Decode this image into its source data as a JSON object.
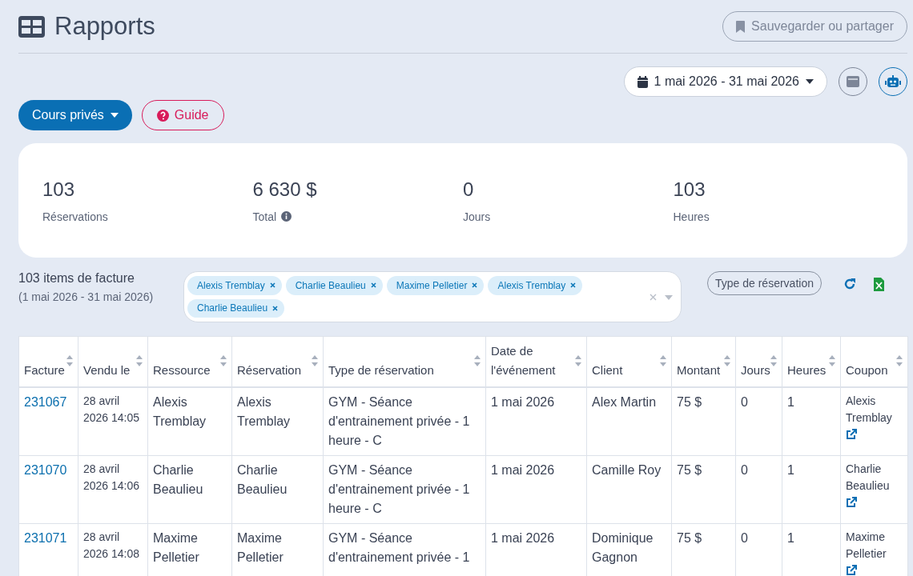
{
  "header": {
    "title": "Rapports",
    "save_button": "Sauvegarder ou partager"
  },
  "date_range": {
    "label": "1 mai 2026 - 31 mai 2026"
  },
  "report_selector": {
    "label": "Cours privés"
  },
  "guide_button": {
    "label": "Guide"
  },
  "stats": [
    {
      "value": "103",
      "label": "Réservations",
      "info": false
    },
    {
      "value": "6 630 $",
      "label": "Total",
      "info": true
    },
    {
      "value": "0",
      "label": "Jours",
      "info": false
    },
    {
      "value": "103",
      "label": "Heures",
      "info": false
    }
  ],
  "summary": {
    "title": "103 items de facture",
    "subtitle": "(1 mai 2026 - 31 mai 2026)"
  },
  "filter_tags": [
    "Alexis Tremblay",
    "Charlie Beaulieu",
    "Maxime Pelletier",
    "Alexis Tremblay",
    "Charlie Beaulieu"
  ],
  "type_filter": {
    "label": "Type de réservation"
  },
  "table": {
    "columns": [
      "Facture",
      "Vendu le",
      "Ressource",
      "Réservation",
      "Type de réservation",
      "Date de l'événement",
      "Client",
      "Montant",
      "Jours",
      "Heures",
      "Coupon"
    ],
    "rows": [
      {
        "invoice": "231067",
        "sold": "28 avril 2026 14:05",
        "resource": "Alexis Tremblay",
        "reservation": "Alexis Tremblay",
        "type": "GYM - Séance d'entrainement privée - 1 heure - C",
        "date": "1 mai 2026",
        "client": "Alex Martin",
        "amount": "75 $",
        "days": "0",
        "hours": "1",
        "coupon": "Alexis Tremblay"
      },
      {
        "invoice": "231070",
        "sold": "28 avril 2026 14:06",
        "resource": "Charlie Beaulieu",
        "reservation": "Charlie Beaulieu",
        "type": "GYM - Séance d'entrainement privée - 1 heure - C",
        "date": "1 mai 2026",
        "client": "Camille Roy",
        "amount": "75 $",
        "days": "0",
        "hours": "1",
        "coupon": "Charlie Beaulieu"
      },
      {
        "invoice": "231071",
        "sold": "28 avril 2026 14:08",
        "resource": "Maxime Pelletier",
        "reservation": "Maxime Pelletier",
        "type": "GYM - Séance d'entrainement privée - 1",
        "date": "1 mai 2026",
        "client": "Dominique Gagnon",
        "amount": "75 $",
        "days": "0",
        "hours": "1",
        "coupon": "Maxime Pelletier"
      }
    ]
  }
}
